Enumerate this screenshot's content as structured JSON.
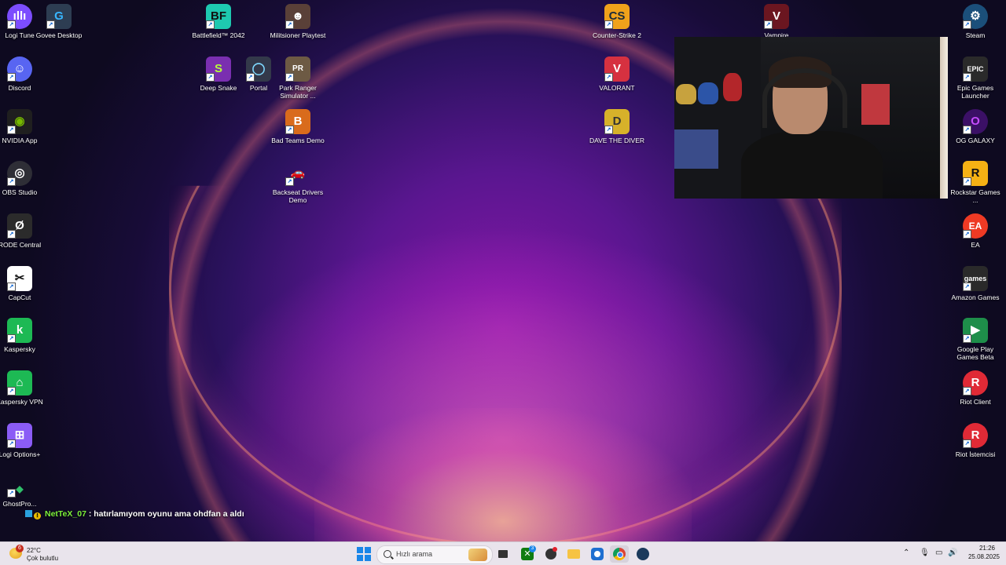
{
  "desktop": {
    "icons": [
      {
        "label": "Logi Tune",
        "glyph": "ıllı",
        "color": "#7c4dff",
        "icon": "logi-tune-icon"
      },
      {
        "label": "Govee Desktop",
        "glyph": "G",
        "color": "#2d3d52",
        "icon": "govee-icon"
      },
      {
        "label": "Battlefield™ 2042",
        "glyph": "BF",
        "color": "#1ec9b0",
        "icon": "battlefield-icon"
      },
      {
        "label": "Militsioner Playtest",
        "glyph": "☻",
        "color": "#5a4038",
        "icon": "militsioner-icon"
      },
      {
        "label": "Counter-Strike 2",
        "glyph": "CS",
        "color": "#f0a21b",
        "icon": "counter-strike-icon"
      },
      {
        "label": "Vampire",
        "glyph": "V",
        "color": "#6b1620",
        "icon": "vampire-icon"
      },
      {
        "label": "Steam",
        "glyph": "⚙",
        "color": "#1b4f7a",
        "icon": "steam-icon"
      },
      {
        "label": "Discord",
        "glyph": "☺",
        "color": "#5865f2",
        "icon": "discord-icon"
      },
      {
        "label": "Deep Snake",
        "glyph": "S",
        "color": "#7a2fb0",
        "icon": "deep-snake-icon"
      },
      {
        "label": "Portal",
        "glyph": "◯",
        "color": "#33394a",
        "icon": "portal-icon"
      },
      {
        "label": "Park Ranger Simulator ...",
        "glyph": "PR",
        "color": "#6d5a44",
        "icon": "park-ranger-icon"
      },
      {
        "label": "VALORANT",
        "glyph": "V",
        "color": "#d63140",
        "icon": "valorant-icon"
      },
      {
        "label": "Epic Games Launcher",
        "glyph": "EPIC",
        "color": "#2a2a2a",
        "icon": "epic-games-icon"
      },
      {
        "label": "NVIDIA App",
        "glyph": "◉",
        "color": "#1f1f1f",
        "icon": "nvidia-icon"
      },
      {
        "label": "Bad Teams Demo",
        "glyph": "B",
        "color": "#d96b1c",
        "icon": "bad-teams-icon"
      },
      {
        "label": "DAVE THE DIVER",
        "glyph": "D",
        "color": "#d7b12a",
        "icon": "dave-the-diver-icon"
      },
      {
        "label": "OG GALAXY",
        "glyph": "O",
        "color": "#3b1066",
        "icon": "gog-galaxy-icon"
      },
      {
        "label": "OBS Studio",
        "glyph": "◎",
        "color": "#2e2e36",
        "icon": "obs-studio-icon"
      },
      {
        "label": "Backseat Drivers Demo",
        "glyph": "🚗",
        "color": "#3a1a2a",
        "icon": "backseat-drivers-icon"
      },
      {
        "label": "Rockstar Games ...",
        "glyph": "R",
        "color": "#f5b114",
        "icon": "rockstar-icon"
      },
      {
        "label": "RODE Central",
        "glyph": "Ø",
        "color": "#2b2b2b",
        "icon": "rode-central-icon"
      },
      {
        "label": "EA",
        "glyph": "EA",
        "color": "#ee3a24",
        "icon": "ea-icon"
      },
      {
        "label": "CapCut",
        "glyph": "✂",
        "color": "#ffffff",
        "icon": "capcut-icon"
      },
      {
        "label": "Amazon Games",
        "glyph": "games",
        "color": "#2a2a2a",
        "icon": "amazon-games-icon"
      },
      {
        "label": "Kaspersky",
        "glyph": "k",
        "color": "#1db954",
        "icon": "kaspersky-icon"
      },
      {
        "label": "Google Play Games Beta",
        "glyph": "▶",
        "color": "#1e8e4a",
        "icon": "google-play-games-icon"
      },
      {
        "label": "Kaspersky VPN",
        "glyph": "⌂",
        "color": "#1db954",
        "icon": "kaspersky-vpn-icon"
      },
      {
        "label": "Riot Client",
        "glyph": "R",
        "color": "#e02a36",
        "icon": "riot-client-icon"
      },
      {
        "label": "Logi Options+",
        "glyph": "⊞",
        "color": "#8b5cf6",
        "icon": "logi-options-icon"
      },
      {
        "label": "Riot İstemcisi",
        "glyph": "R",
        "color": "#e02a36",
        "icon": "riot-istemcisi-icon"
      },
      {
        "label": "GhostPro...",
        "glyph": "◆",
        "color": "#1e6b3a",
        "icon": "ghostpro-icon"
      }
    ]
  },
  "chat": {
    "username": "NetTeX_07",
    "separator": " : ",
    "message": "hatırlamıyom oyunu ama ohdfan a aldı",
    "badge_level": "!"
  },
  "taskbar": {
    "weather": {
      "temp": "22°C",
      "desc": "Çok bulutlu",
      "badge": "6"
    },
    "search_placeholder": "Hızlı arama",
    "clock": {
      "time": "21:26",
      "date": "25.08.2025"
    },
    "pinned": [
      {
        "icon": "start-menu-icon"
      },
      {
        "icon": "task-view-icon"
      },
      {
        "icon": "xbox-icon",
        "badge": "3"
      },
      {
        "icon": "app-icon"
      },
      {
        "icon": "file-explorer-icon"
      },
      {
        "icon": "snipping-tool-icon"
      },
      {
        "icon": "chrome-icon"
      },
      {
        "icon": "steam-taskbar-icon"
      }
    ],
    "tray": {
      "chevron": "⌃",
      "mic": "🎙",
      "display": "▭",
      "volume": "🔊"
    }
  }
}
